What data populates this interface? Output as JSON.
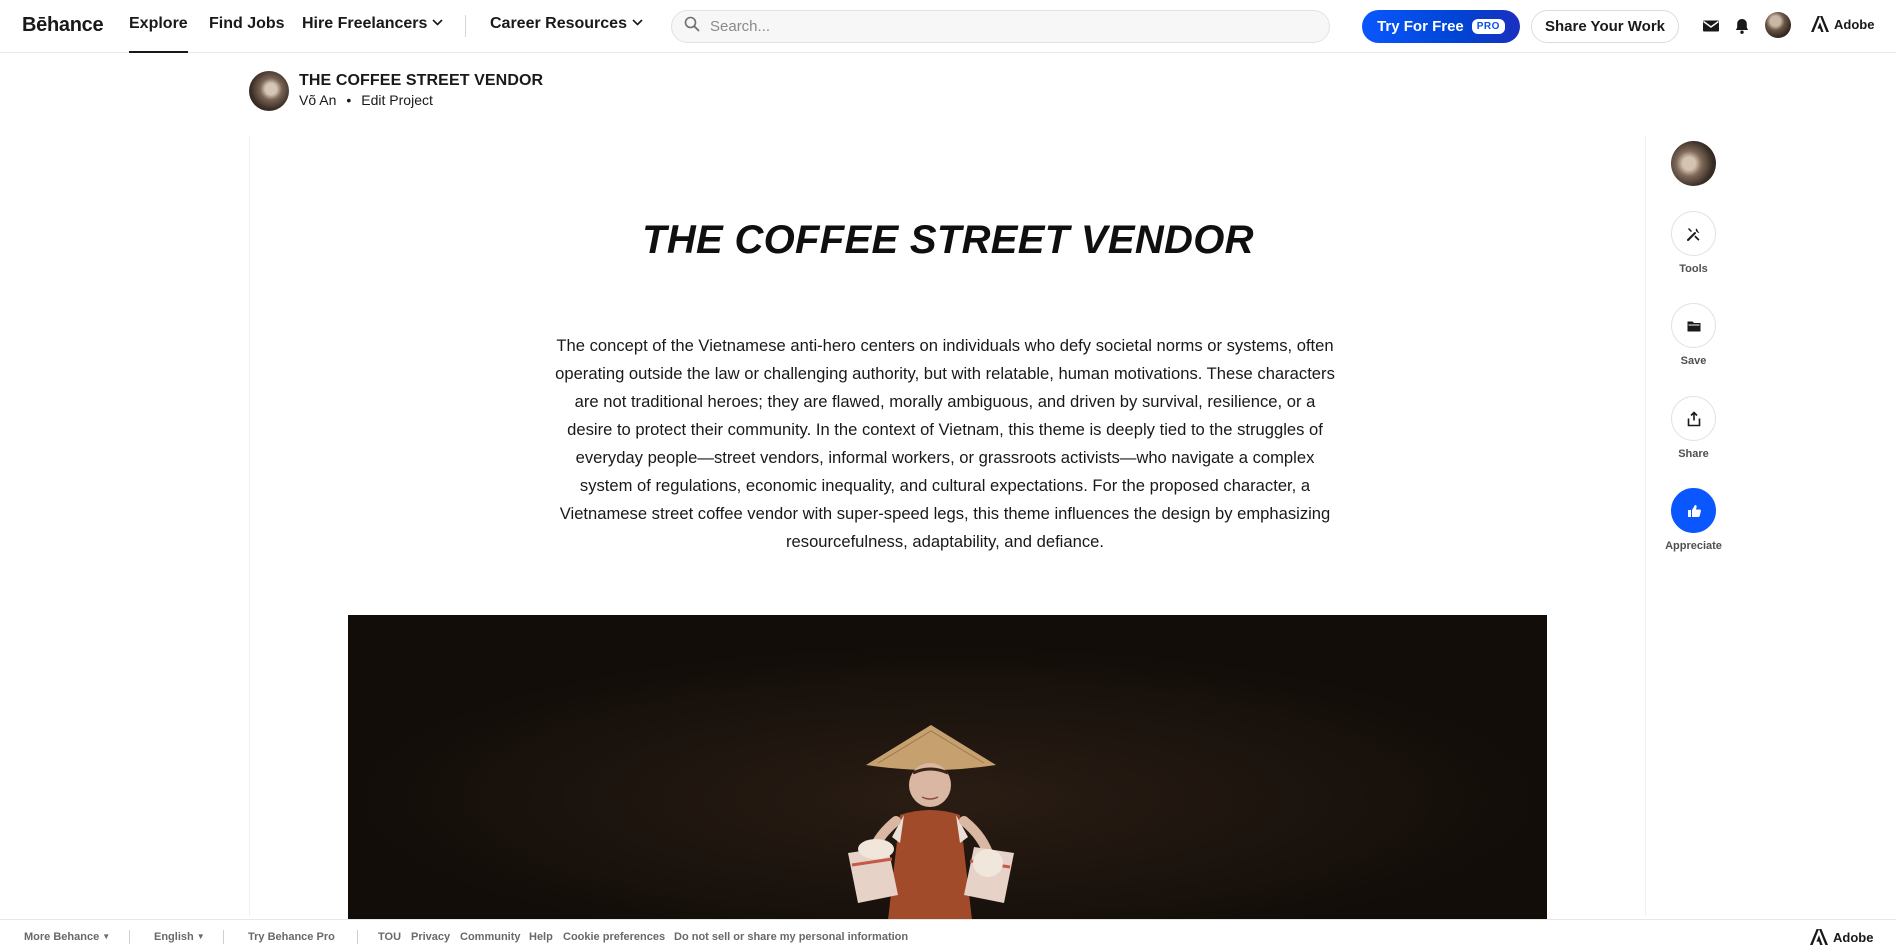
{
  "nav": {
    "logo": "Bēhance",
    "links": [
      "Explore",
      "Find Jobs",
      "Hire Freelancers",
      "Career Resources"
    ],
    "search_placeholder": "Search...",
    "try_free": "Try For Free",
    "pro_badge": "PRO",
    "share_work": "Share Your Work",
    "adobe": "Adobe"
  },
  "project": {
    "title": "THE COFFEE STREET VENDOR",
    "author": "Võ An",
    "edit": "Edit Project",
    "heading": "THE COFFEE STREET VENDOR",
    "description": "The concept of the Vietnamese anti-hero centers on individuals who defy societal norms or systems, often operating outside the law or challenging authority, but with relatable, human motivations. These characters are not traditional heroes; they are flawed, morally ambiguous, and driven by survival, resilience, or a desire to protect their community. In the context of Vietnam, this theme is deeply tied to the struggles of everyday people—street vendors, informal workers, or grassroots activists—who navigate a complex system of regulations, economic inequality, and cultural expectations. For the proposed character, a Vietnamese street coffee vendor with super-speed legs, this theme influences the design by emphasizing resourcefulness, adaptability, and defiance."
  },
  "side_actions": {
    "tools": "Tools",
    "save": "Save",
    "share": "Share",
    "appreciate": "Appreciate"
  },
  "footer": {
    "more_behance": "More Behance",
    "language": "English",
    "try_pro": "Try Behance Pro",
    "links": [
      "TOU",
      "Privacy",
      "Community",
      "Help",
      "Cookie preferences",
      "Do not sell or share my personal information"
    ],
    "adobe": "Adobe"
  },
  "colors": {
    "accent_blue": "#0b57ff",
    "text": "#191919",
    "image_bg": "#120d09"
  }
}
